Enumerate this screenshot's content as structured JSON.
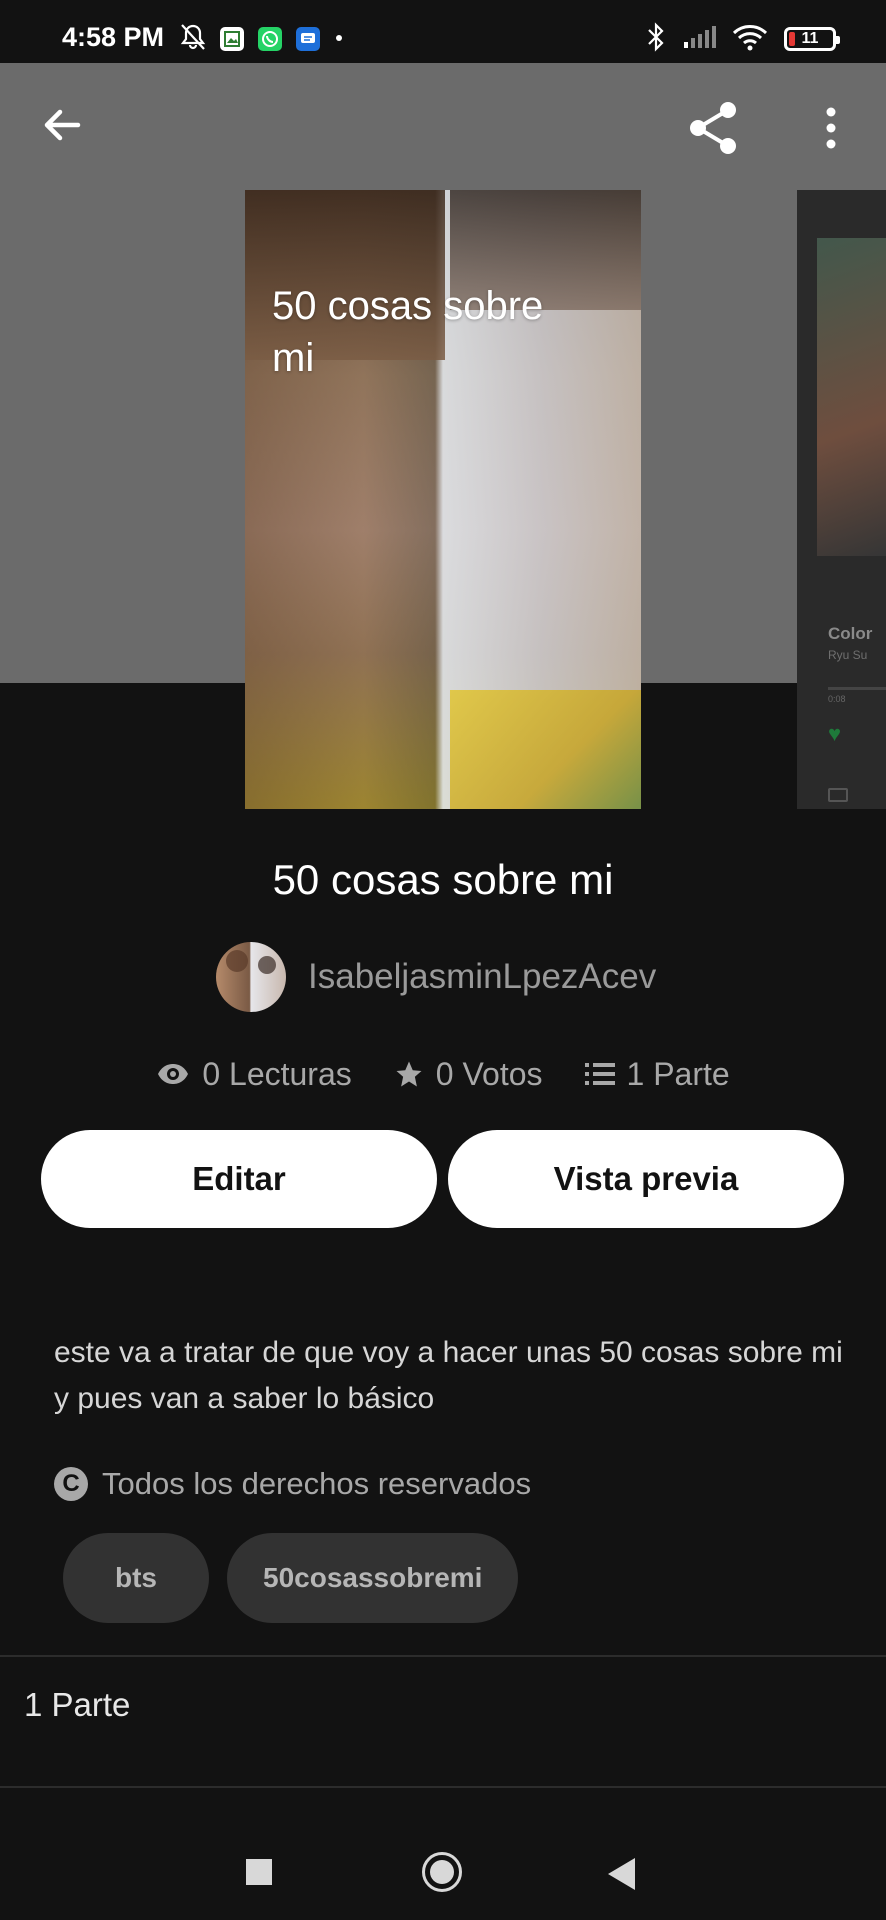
{
  "status_bar": {
    "time": "4:58 PM",
    "battery": "11",
    "icons_left": [
      "mute-bell-icon",
      "gallery-app-icon",
      "whatsapp-icon",
      "messages-app-icon",
      "dot-icon"
    ],
    "icons_right": [
      "bluetooth-icon",
      "signal-icon",
      "wifi-icon",
      "battery-icon"
    ]
  },
  "header": {
    "actions": [
      "back-arrow-icon",
      "share-icon",
      "more-vert-icon"
    ]
  },
  "cover": {
    "title": "50 cosas sobre mi"
  },
  "next_cover": {
    "title": "Color",
    "subtitle": "Ryu Su",
    "time": "0:08"
  },
  "story": {
    "title": "50 cosas sobre mi",
    "author": "IsabeljasminLpezAcev",
    "stats": {
      "reads": "0 Lecturas",
      "votes": "0 Votos",
      "parts": "1 Parte"
    },
    "buttons": {
      "edit": "Editar",
      "preview": "Vista previa"
    },
    "description": "este va a tratar de que voy a hacer unas 50 cosas sobre mi y pues van a saber lo básico",
    "copyright": "Todos los derechos reservados",
    "tags": [
      "bts",
      "50cosassobremi"
    ],
    "parts_section_title": "1 Parte"
  },
  "colors": {
    "background": "#121212",
    "header_bg": "#6b6b6b",
    "button_bg": "#ffffff",
    "tag_bg": "#323232",
    "muted_text": "#a8a8a8"
  }
}
